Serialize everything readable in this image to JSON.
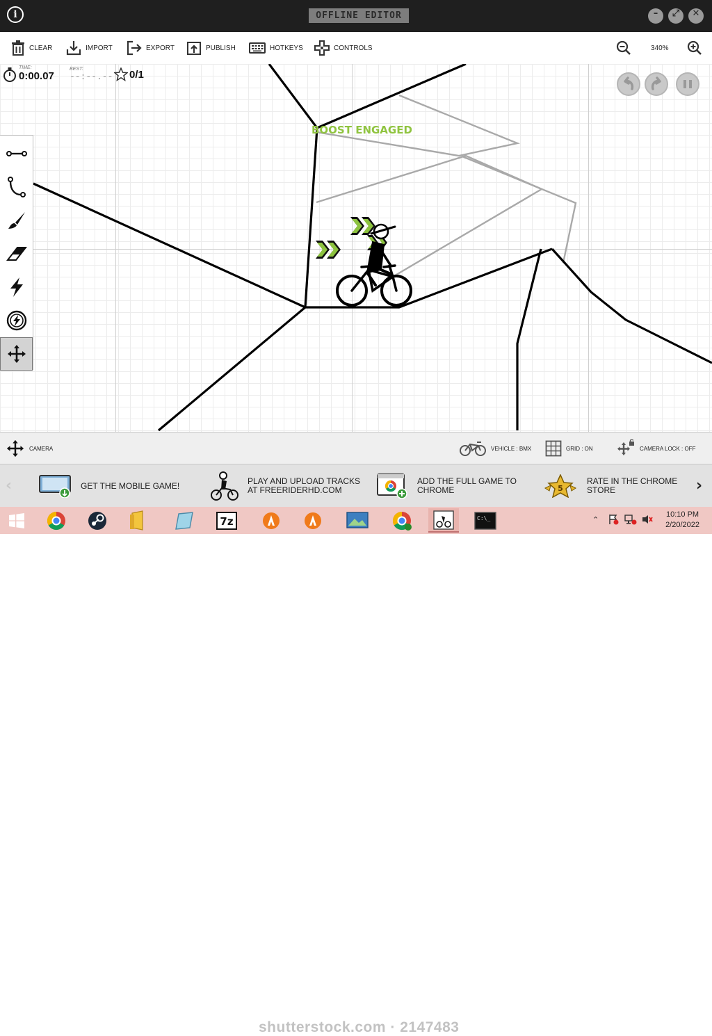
{
  "window": {
    "title": "OFFLINE EDITOR",
    "info_icon": "i",
    "minimize_icon": "–",
    "maximize_icon": "⤢",
    "close_icon": "✕"
  },
  "toolbar": {
    "clear": "CLEAR",
    "import": "IMPORT",
    "export": "EXPORT",
    "publish": "PUBLISH",
    "hotkeys": "HOTKEYS",
    "controls": "CONTROLS",
    "zoom": "340%"
  },
  "hud": {
    "time_label": "TIME:",
    "time_value": "0:00.07",
    "best_label": "BEST:",
    "best_value": "--:--.--",
    "stars": "0/1",
    "boost_message": "BOOST ENGAGED"
  },
  "tools": [
    "straight-line",
    "curve",
    "brush",
    "eraser",
    "boost",
    "gravity",
    "camera-move"
  ],
  "statusbar": {
    "camera": "CAMERA",
    "vehicle": "VEHICLE : BMX",
    "grid": "GRID : ON",
    "camera_lock": "CAMERA LOCK : OFF"
  },
  "promo": [
    {
      "text": "GET THE MOBILE GAME!"
    },
    {
      "text": "PLAY AND UPLOAD TRACKS\nAT FREERIDERHD.COM"
    },
    {
      "text": "ADD THE FULL GAME TO\nCHROME"
    },
    {
      "text": "RATE IN THE CHROME\nSTORE",
      "badge": "5"
    }
  ],
  "taskbar": {
    "time": "10:10 PM",
    "date": "2/20/2022",
    "watermark": "shutterstock.com · 2147483"
  },
  "colors": {
    "boost_green": "#90c440",
    "taskbar_bg": "#f0c8c4",
    "titlebar_bg": "#1f1f1f"
  }
}
